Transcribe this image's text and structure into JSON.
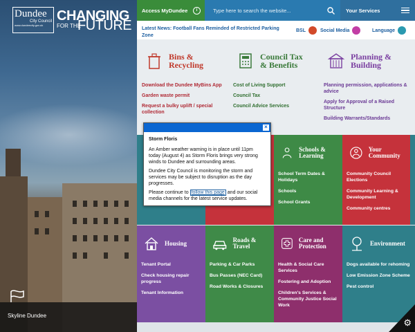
{
  "logo": {
    "name": "Dundee",
    "sub": "City Council",
    "url": "www.dundeecity.gov.uk"
  },
  "slogan": {
    "line1": "CHANGING",
    "line2": "FOR THE",
    "line3": "FUTURE"
  },
  "hero_caption": "Skyline Dundee",
  "topbar": {
    "account_label": "Access MyDundee",
    "search_placeholder": "Type here to search the website...",
    "services_label": "Your Services"
  },
  "news": {
    "text": "Latest News: Football Fans Reminded of Restricted Parking Zone",
    "links": [
      "BSL",
      "Social Media",
      "Language"
    ]
  },
  "services_top": [
    {
      "title_line1": "Bins &",
      "title_line2": "Recycling",
      "color": "#c0392b",
      "links": [
        "Download the Dundee MyBins App",
        "Garden waste permit",
        "Request a bulky uplift / special collection"
      ]
    },
    {
      "title_line1": "Council Tax",
      "title_line2": "& Benefits",
      "color": "#3a7a3a",
      "links": [
        "Cost of Living Support",
        "Council Tax",
        "Council Advice Services"
      ]
    },
    {
      "title_line1": "Planning &",
      "title_line2": "Building",
      "color": "#7a3fa0",
      "links": [
        "Planning permission, applications & advice",
        "Apply for Approval of a Raised Structure",
        "Building Warrants/Standards"
      ]
    }
  ],
  "tiles_row2": [
    {
      "title": "Schools & Learning",
      "color": "#3e8a46",
      "links": [
        "School Term Dates & Holidays",
        "Schools",
        "School Grants"
      ]
    },
    {
      "title": "Your Community",
      "color": "#c5323b",
      "links": [
        "Community Council Elections",
        "Community Learning & Development",
        "Community centres"
      ]
    }
  ],
  "tiles_row3": [
    {
      "title": "Housing",
      "color": "#7b4fa2",
      "links": [
        "Tenant Portal",
        "Check housing repair progress",
        "Tenant Information"
      ]
    },
    {
      "title": "Roads & Travel",
      "color": "#3f8a48",
      "links": [
        "Parking & Car Parks",
        "Bus Passes (NEC Card)",
        "Road Works & Closures"
      ]
    },
    {
      "title": "Care and Protection",
      "color": "#8e2f6c",
      "links": [
        "Health & Social Care Services",
        "Fostering and Adoption",
        "Children's Services & Community Justice Social Work"
      ]
    },
    {
      "title": "Environment",
      "color": "#2f7f8a",
      "links": [
        "Dogs available for rehoming",
        "Low Emission Zone Scheme",
        "Pest control"
      ]
    }
  ],
  "modal": {
    "title": "Storm Floris",
    "p1": "An Amber weather warning is in place until 11pm today (August 4) as Storm Floris brings very strong winds to Dundee and surrounding areas.",
    "p2": "Dundee City Council is monitoring the storm and services may be subject to disruption as the day progresses.",
    "p3_before": "Please continue to",
    "p3_link": "follow this page",
    "p3_after": "and our social media channels for the latest service updates."
  },
  "colors": {
    "green": "#3a8c3a",
    "blue": "#2a7ab0",
    "darkblue": "#2f6f9e",
    "modal_bar": "#0a66d1"
  },
  "icons": [
    "info-icon",
    "search-icon",
    "menu-icon",
    "bin-icon",
    "calculator-icon",
    "building-icon",
    "gear-icon"
  ]
}
